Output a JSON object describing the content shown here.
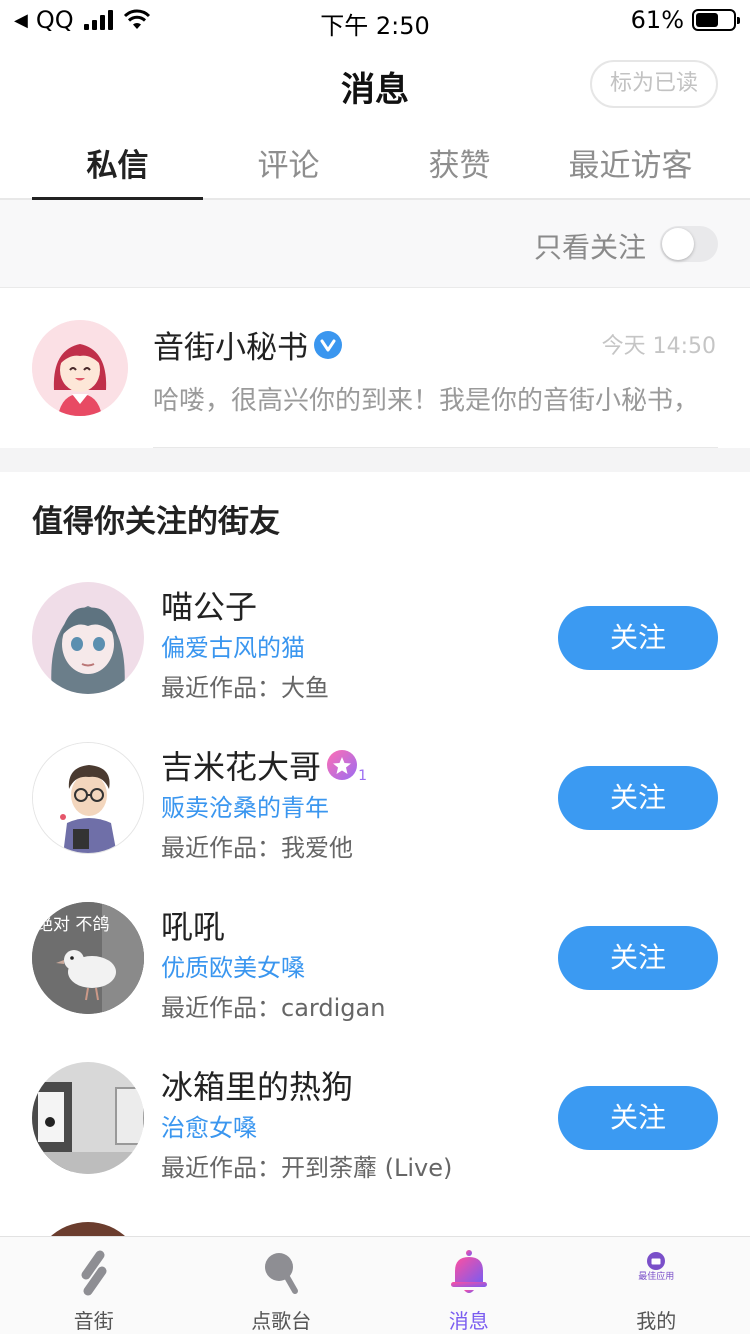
{
  "status_bar": {
    "carrier": "QQ",
    "time": "下午 2:50",
    "battery_percent": "61%",
    "battery_level": 0.61
  },
  "header": {
    "title": "消息",
    "mark_read_label": "标为已读"
  },
  "tabs": [
    {
      "label": "私信",
      "active": true
    },
    {
      "label": "评论",
      "active": false
    },
    {
      "label": "获赞",
      "active": false
    },
    {
      "label": "最近访客",
      "active": false
    }
  ],
  "filter": {
    "label": "只看关注",
    "toggle_on": false
  },
  "messages": [
    {
      "name": "音街小秘书",
      "verified": true,
      "time": "今天 14:50",
      "preview": "哈喽，很高兴你的到来！我是你的音街小秘书，"
    }
  ],
  "recommend": {
    "title": "值得你关注的街友",
    "users": [
      {
        "name": "喵公子",
        "desc": "偏爱古风的猫",
        "work": "最近作品：大鱼",
        "follow_label": "关注",
        "badge": ""
      },
      {
        "name": "吉米花大哥",
        "desc": "贩卖沧桑的青年",
        "work": "最近作品：我爱他",
        "follow_label": "关注",
        "badge": "1"
      },
      {
        "name": "吼吼",
        "desc": "优质欧美女嗓",
        "work": "最近作品：cardigan",
        "follow_label": "关注",
        "badge": "",
        "avatar_caption": "绝对 不鸽"
      },
      {
        "name": "冰箱里的热狗",
        "desc": "治愈女嗓",
        "work": "最近作品：开到荼蘼 (Live)",
        "follow_label": "关注",
        "badge": ""
      }
    ]
  },
  "tabbar": [
    {
      "label": "音街",
      "icon": "music-street-icon",
      "active": false
    },
    {
      "label": "点歌台",
      "icon": "microphone-icon",
      "active": false
    },
    {
      "label": "消息",
      "icon": "bell-icon",
      "active": true
    },
    {
      "label": "我的",
      "icon": "best-app-icon",
      "active": false,
      "icon_caption": "最佳应用"
    }
  ],
  "colors": {
    "accent_blue": "#3b9af2",
    "active_tab_purple": "#7a5cf0"
  }
}
